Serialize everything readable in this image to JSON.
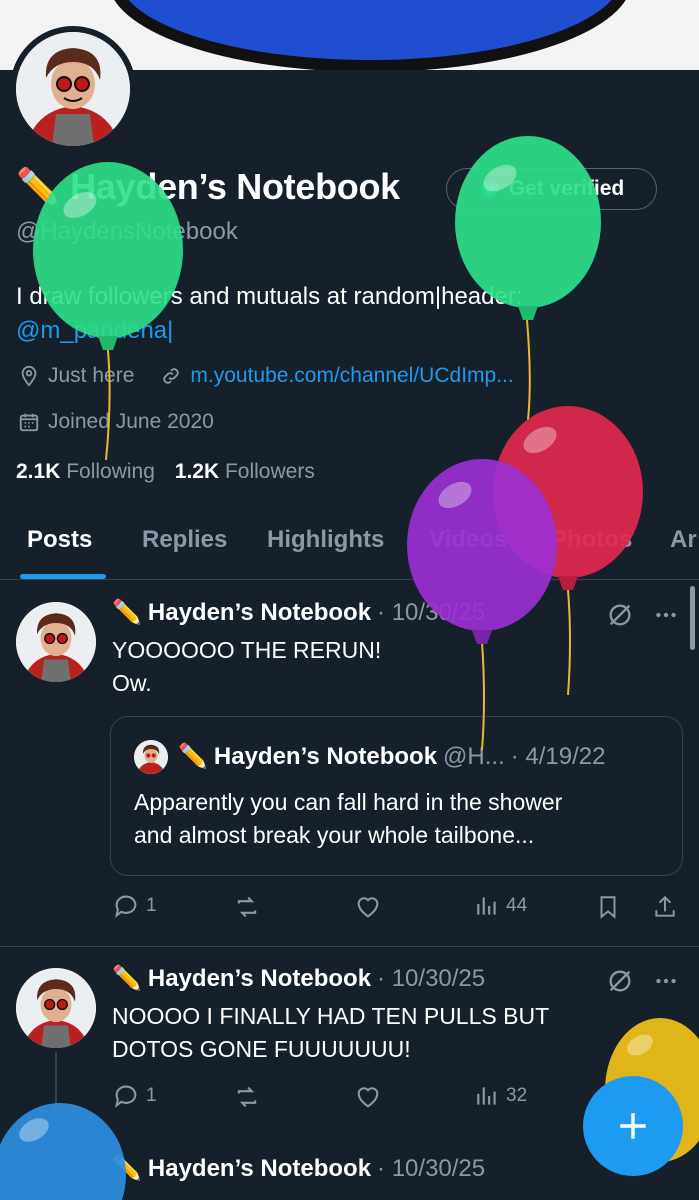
{
  "profile": {
    "name": "Hayden’s Notebook",
    "name_emoji": "✏️",
    "verify_label": "Get verified",
    "handle": "@HaydensNotebook",
    "bio_text": "I draw followers and mutuals at random|header: ",
    "bio_mention": "@m_pandena|",
    "location": "Just here",
    "website": "m.youtube.com/channel/UCdImp...",
    "joined": "Joined June 2020",
    "following_count": "2.1K",
    "following_label": "Following",
    "followers_count": "1.2K",
    "followers_label": "Followers"
  },
  "tabs": [
    "Posts",
    "Replies",
    "Highlights",
    "Videos",
    "Photos",
    "Ar"
  ],
  "posts": [
    {
      "name": "Hayden’s Notebook",
      "date": "· 10/30/25",
      "lines": [
        "YOOOOOO THE RERUN!",
        "Ow."
      ],
      "quote": {
        "name": "Hayden’s Notebook",
        "handle": "@H...",
        "date": "· 4/19/22",
        "lines": [
          "Apparently you can fall hard in the shower",
          "and almost break your whole tailbone..."
        ]
      },
      "replies": "1",
      "views": "44"
    },
    {
      "name": "Hayden’s Notebook",
      "date": "· 10/30/25",
      "lines": [
        "NOOOO I FINALLY HAD TEN PULLS BUT",
        "DOTOS GONE FUUUUUUU!"
      ],
      "replies": "1",
      "views": "32"
    },
    {
      "name": "Hayden’s Notebook",
      "date": "· 10/30/25"
    }
  ],
  "colors": {
    "background": "#15202b",
    "accent": "#1d9bf0",
    "muted": "#8b98a5",
    "balloon_green": "#2ee08a",
    "balloon_purple": "#9b2fd1",
    "balloon_red": "#e3284f",
    "balloon_blue": "#2d8fe0",
    "balloon_yellow": "#f2c218"
  }
}
